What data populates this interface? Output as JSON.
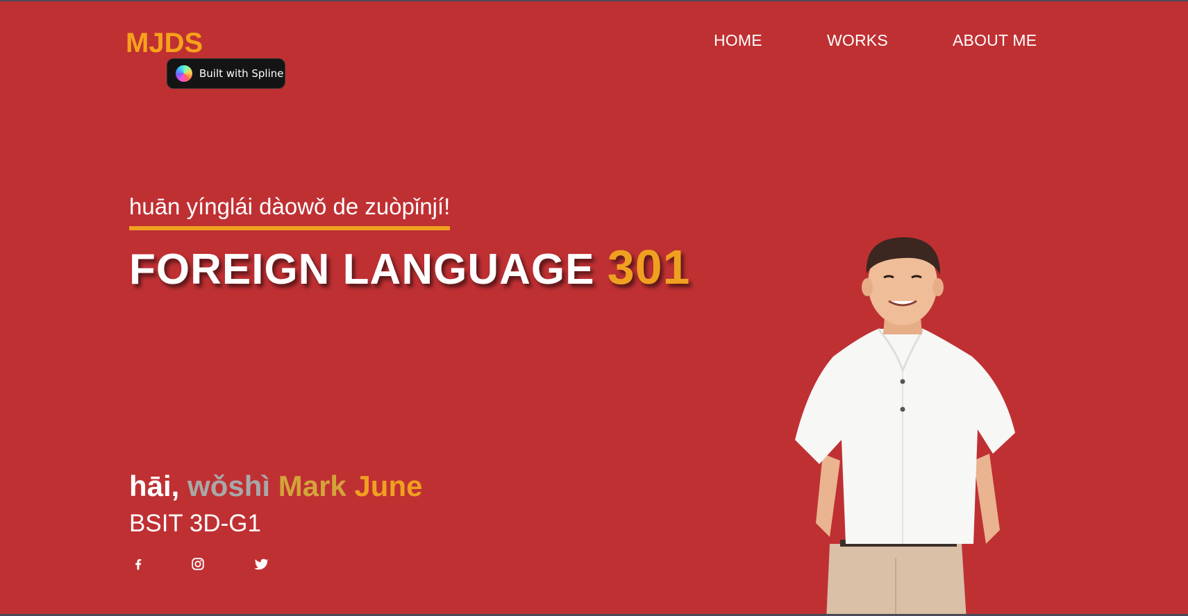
{
  "header": {
    "logo": "MJDS",
    "badge_label": "Built with Spline",
    "nav": [
      {
        "label": "HOME"
      },
      {
        "label": "WORKS"
      },
      {
        "label": "ABOUT ME"
      }
    ]
  },
  "hero": {
    "greeting": "huān yínglái dàowǒ de zuòpǐnjí!",
    "headline_main": "FOREIGN LANGUAGE",
    "headline_accent": "301",
    "intro_part1": "hāi,",
    "intro_part2": "wǒshì",
    "intro_part3": "Mark",
    "intro_part4": "June",
    "section": "BSIT 3D-G1"
  },
  "social": [
    {
      "icon": "facebook-icon"
    },
    {
      "icon": "instagram-icon"
    },
    {
      "icon": "twitter-icon"
    }
  ],
  "colors": {
    "background": "#bf3033",
    "accent": "#f0a020",
    "text": "#ffffff"
  }
}
